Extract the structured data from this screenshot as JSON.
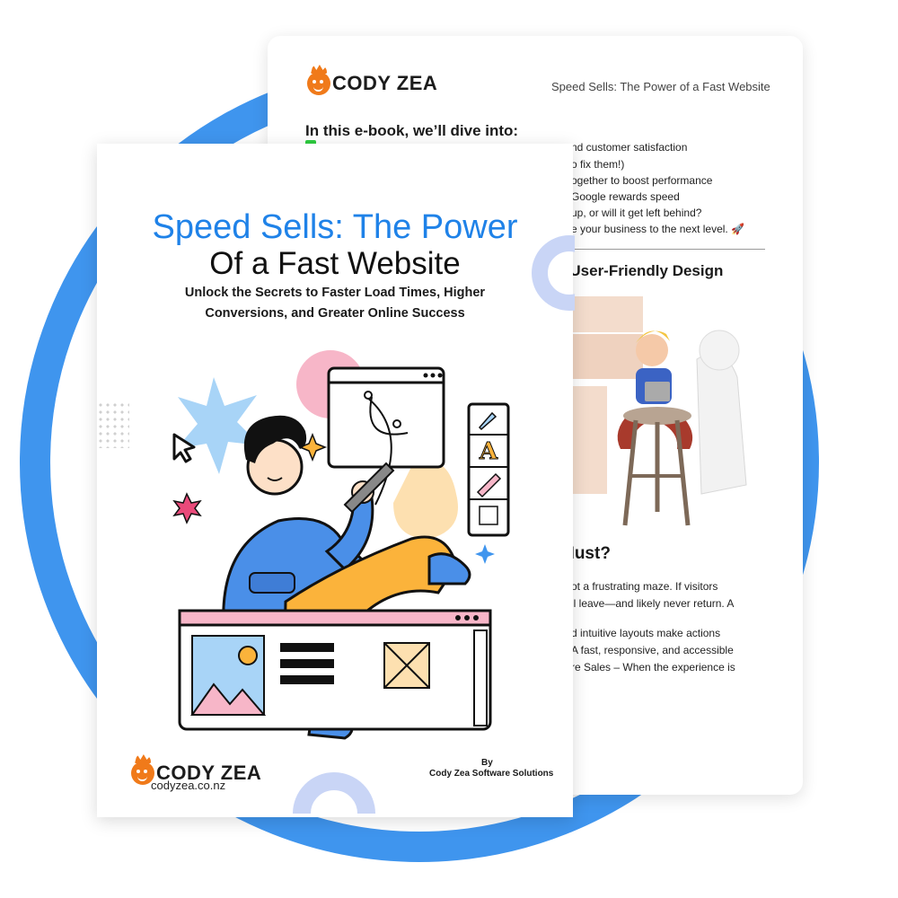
{
  "back_page": {
    "brand": "CODY ZEA",
    "header_title": "Speed Sells: The Power of a Fast Website",
    "intro_heading": "In this e-book, we’ll dive into:",
    "bullet_lines": [
      "nd customer satisfaction",
      "o fix them!)",
      "ogether to boost performance",
      "Google rewards speed",
      "up, or will it get left behind?",
      "e your business to the next level. 🚀"
    ],
    "section_heading": "f User-Friendly Design",
    "subsection_heading": "Must?",
    "paragraph_lines": [
      "ot a frustrating maze. If visitors",
      "ll leave—and likely never return. A",
      "d intuitive layouts make actions",
      "A fast, responsive, and accessible",
      "re Sales – When the experience is"
    ]
  },
  "front_cover": {
    "title_line1": "Speed Sells: The Power",
    "title_line2": "Of a Fast Website",
    "subtitle_line1": "Unlock the Secrets to Faster Load Times, Higher",
    "subtitle_line2": "Conversions, and Greater Online Success",
    "brand": "CODY ZEA",
    "website": "codyzea.co.nz",
    "by_label": "By",
    "company": "Cody Zea Software Solutions",
    "icon_letter": "A"
  },
  "colors": {
    "ring_blue": "#3f95ee",
    "title_blue": "#1f82e8",
    "logo_orange": "#f07a1a",
    "hoodie_blue": "#4a8fe8",
    "pants_yellow": "#fbb33b",
    "accent_pink": "#f7b6c8"
  }
}
